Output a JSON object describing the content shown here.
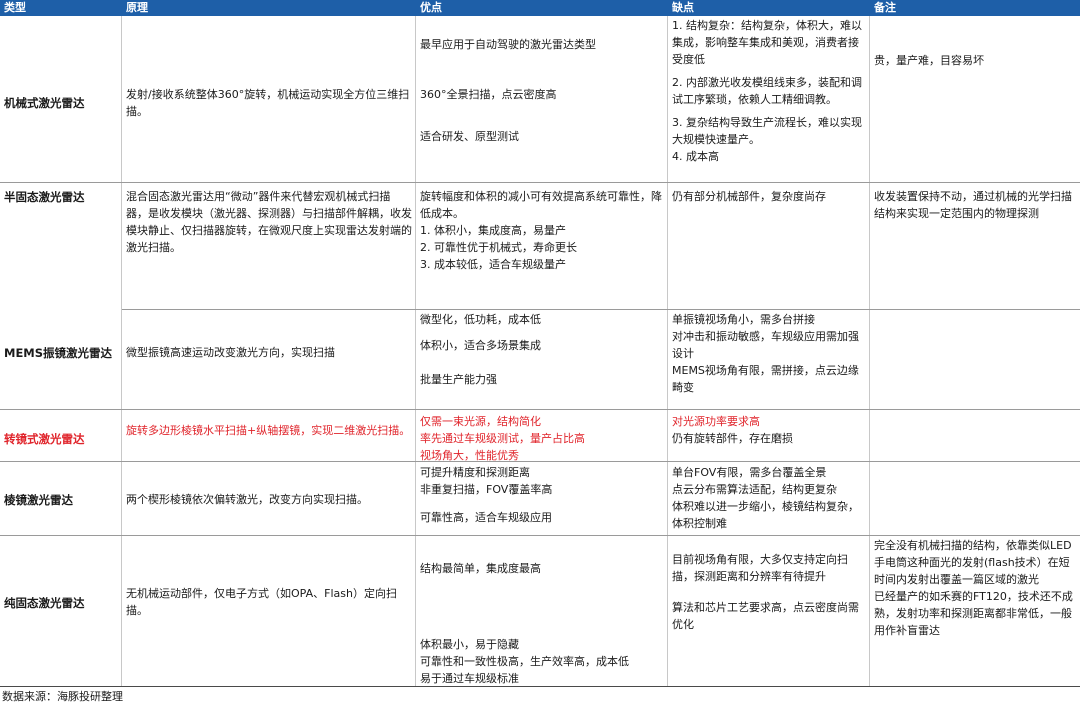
{
  "header": {
    "type": "类型",
    "principle": "原理",
    "pros": "优点",
    "cons": "缺点",
    "notes": "备注"
  },
  "rows": [
    {
      "type": "机械式激光雷达",
      "principle": "发射/接收系统整体360°旋转，机械运动实现全方位三维扫描。",
      "pros": [
        "最早应用于自动驾驶的激光雷达类型",
        "360°全景扫描，点云密度高",
        "适合研发、原型测试"
      ],
      "cons": [
        "1. 结构复杂：结构复杂，体积大，难以集成，影响整车集成和美观，消费者接受度低",
        "2. 内部激光收发模组线束多，装配和调试工序繁琐，依赖人工精细调教。",
        "3. 复杂结构导致生产流程长，难以实现大规模快速量产。",
        "4. 成本高"
      ],
      "notes": "贵，量产难，目容易坏"
    },
    {
      "type": "半固态激光雷达",
      "principle": "混合固态激光雷达用“微动”器件来代替宏观机械式扫描器，是收发模块（激光器、探测器）与扫描部件解耦，收发模块静止、仅扫描器旋转，在微观尺度上实现雷达发射端的激光扫描。",
      "pros": [
        "旋转幅度和体积的减小可有效提高系统可靠性，降低成本。",
        "1. 体积小，集成度高，易量产",
        "2. 可靠性优于机械式，寿命更长",
        "3. 成本较低，适合车规级量产"
      ],
      "cons": [
        "仍有部分机械部件，复杂度尚存"
      ],
      "notes": "收发装置保持不动，通过机械的光学扫描结构来实现一定范围内的物理探测"
    },
    {
      "type": "MEMS振镜激光雷达",
      "principle": "微型振镜高速运动改变激光方向，实现扫描",
      "pros": [
        "微型化，低功耗，成本低",
        "体积小，适合多场景集成",
        "批量生产能力强"
      ],
      "cons": [
        "单振镜视场角小，需多台拼接",
        "对冲击和振动敏感，车规级应用需加强设计",
        "MEMS视场角有限，需拼接，点云边缘畸变"
      ],
      "notes": ""
    },
    {
      "type": "转镜式激光雷达",
      "principle": "旋转多边形棱镜水平扫描+纵轴摆镜，实现二维激光扫描。",
      "pros": [
        "仅需一束光源，结构简化",
        "率先通过车规级测试，量产占比高",
        "视场角大，性能优秀"
      ],
      "cons_red": "对光源功率要求高",
      "cons": [
        "仍有旋转部件，存在磨损"
      ],
      "notes": ""
    },
    {
      "type": "棱镜激光雷达",
      "principle": "两个楔形棱镜依次偏转激光，改变方向实现扫描。",
      "pros": [
        "可提升精度和探测距离",
        "非重复扫描，FOV覆盖率高",
        "可靠性高，适合车规级应用"
      ],
      "cons": [
        "单台FOV有限，需多台覆盖全景",
        "点云分布需算法适配，结构更复杂",
        "体积难以进一步缩小，棱镜结构复杂，体积控制难"
      ],
      "notes": ""
    },
    {
      "type": "纯固态激光雷达",
      "principle": "无机械运动部件，仅电子方式（如OPA、Flash）定向扫描。",
      "pros": [
        "结构最简单，集成度最高",
        "体积最小，易于隐藏",
        "可靠性和一致性极高，生产效率高，成本低",
        "易于通过车规级标准"
      ],
      "cons": [
        "目前视场角有限，大多仅支持定向扫描，探测距离和分辨率有待提升",
        "算法和芯片工艺要求高，点云密度尚需优化"
      ],
      "notes": "完全没有机械扫描的结构，依靠类似LED手电筒这种面光的发射(flash技术）在短时间内发射出覆盖一篇区域的激光\n已经量产的如禾赛的FT120，技术还不成熟，发射功率和探测距离都非常低，一般用作补盲雷达"
    }
  ],
  "footer": "数据来源：海豚投研整理",
  "colors": {
    "header_bg": "#1e5fa8",
    "highlight": "#e0242b"
  }
}
